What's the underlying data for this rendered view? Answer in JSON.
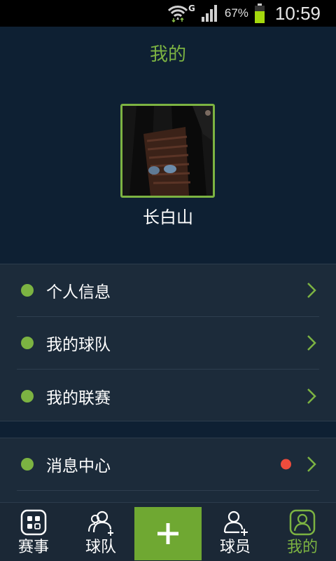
{
  "status_bar": {
    "network_label": "G",
    "battery_percent": "67%",
    "time": "10:59"
  },
  "header": {
    "title": "我的"
  },
  "profile": {
    "username": "长白山"
  },
  "menu": {
    "items": [
      {
        "label": "个人信息"
      },
      {
        "label": "我的球队"
      },
      {
        "label": "我的联赛"
      }
    ],
    "secondary": [
      {
        "label": "消息中心",
        "has_notification": true
      }
    ]
  },
  "bottom_nav": {
    "items": [
      {
        "label": "赛事",
        "icon": "grid-icon"
      },
      {
        "label": "球队",
        "icon": "team-add-icon"
      },
      {
        "label": "",
        "icon": "plus-icon"
      },
      {
        "label": "球员",
        "icon": "player-add-icon"
      },
      {
        "label": "我的",
        "icon": "user-icon",
        "active": true
      }
    ]
  },
  "colors": {
    "accent": "#7cb342",
    "background": "#0e2033",
    "panel": "#1c2b3a",
    "notification": "#ef4c3c"
  }
}
